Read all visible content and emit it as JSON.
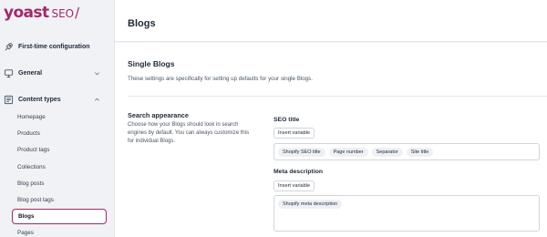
{
  "logo": {
    "brand": "yoast",
    "product": "SEO",
    "slash": "/"
  },
  "sidebar": {
    "nav": [
      {
        "label": "First-time configuration",
        "icon": "rocket-icon"
      },
      {
        "label": "General",
        "icon": "monitor-icon"
      },
      {
        "label": "Content types",
        "icon": "document-icon"
      }
    ],
    "sub_items": [
      "Homepage",
      "Products",
      "Product tags",
      "Collections",
      "Blog posts",
      "Blog post tags",
      "Blogs",
      "Pages"
    ],
    "active": "Blogs"
  },
  "header": {
    "title": "Blogs"
  },
  "section": {
    "title": "Single Blogs",
    "description": "These settings are specifically for setting up defaults for your single Blogs."
  },
  "search_appearance": {
    "title": "Search appearance",
    "description": "Choose how your Blogs should look in search engines by default. You can always customize this for individual Blogs."
  },
  "seo_title": {
    "label": "SEO title",
    "insert_label": "Insert variable",
    "pills": [
      "Shopify SEO title",
      "Page number",
      "Separator",
      "Site title"
    ]
  },
  "meta_description": {
    "label": "Meta description",
    "insert_label": "Insert variable",
    "pills": [
      "Shopify meta description"
    ]
  },
  "colors": {
    "brand": "#a4286a"
  }
}
